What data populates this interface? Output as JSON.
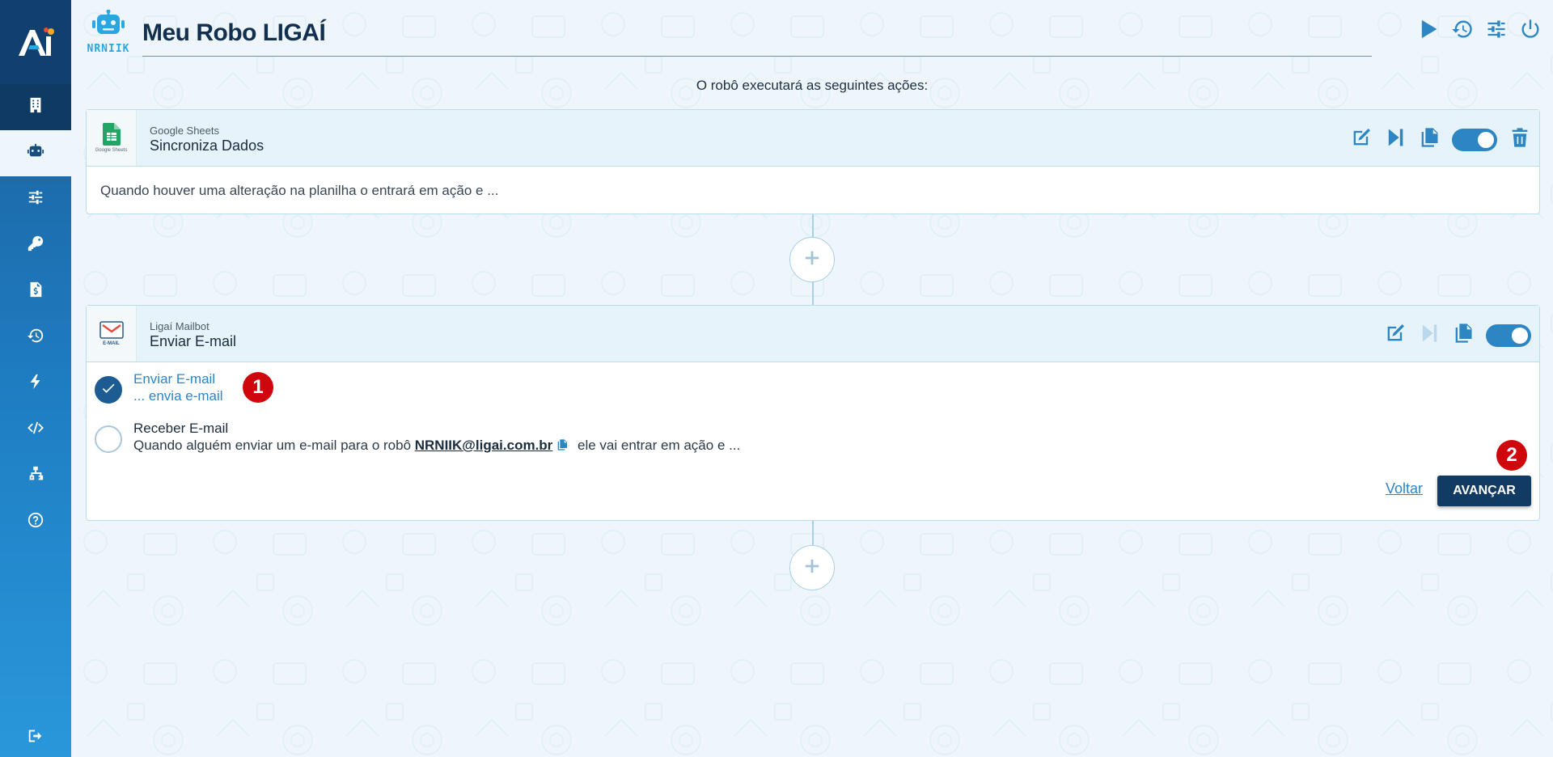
{
  "app": {
    "robot_name": "NRNIIK",
    "title": "Meu Robo LIGAÍ",
    "subtitle": "O robô executará as seguintes ações:"
  },
  "sidebar": {
    "items": [
      {
        "icon": "building-icon"
      },
      {
        "icon": "robot-icon"
      },
      {
        "icon": "sliders-icon"
      },
      {
        "icon": "key-icon"
      },
      {
        "icon": "invoice-icon"
      },
      {
        "icon": "history-icon"
      },
      {
        "icon": "bolt-icon"
      },
      {
        "icon": "code-icon"
      },
      {
        "icon": "sitemap-icon"
      },
      {
        "icon": "help-icon"
      }
    ],
    "logout_icon": "logout-icon"
  },
  "header_actions": [
    "play-icon",
    "history-icon",
    "sliders-icon",
    "power-icon"
  ],
  "step1": {
    "icon_caption": "Google Sheets",
    "provider": "Google Sheets",
    "name": "Sincroniza Dados",
    "description": "Quando houver uma alteração na planilha o entrará em ação e ..."
  },
  "step2": {
    "icon_caption": "E-MAIL",
    "provider": "Ligaí Mailbot",
    "name": "Enviar E-mail",
    "options": [
      {
        "title": "Enviar E-mail",
        "desc": "... envia e-mail",
        "selected": true
      },
      {
        "title": "Receber E-mail",
        "desc_prefix": "Quando alguém enviar um e-mail para o robô ",
        "email": "NRNIIK@ligai.com.br",
        "desc_suffix": " ele vai entrar em ação e ...",
        "selected": false
      }
    ],
    "back_label": "Voltar",
    "next_label": "AVANÇAR"
  },
  "badges": [
    "1",
    "2"
  ],
  "colors": {
    "primary": "#2c86c4",
    "dark": "#123b63",
    "badge": "#d0060d"
  }
}
